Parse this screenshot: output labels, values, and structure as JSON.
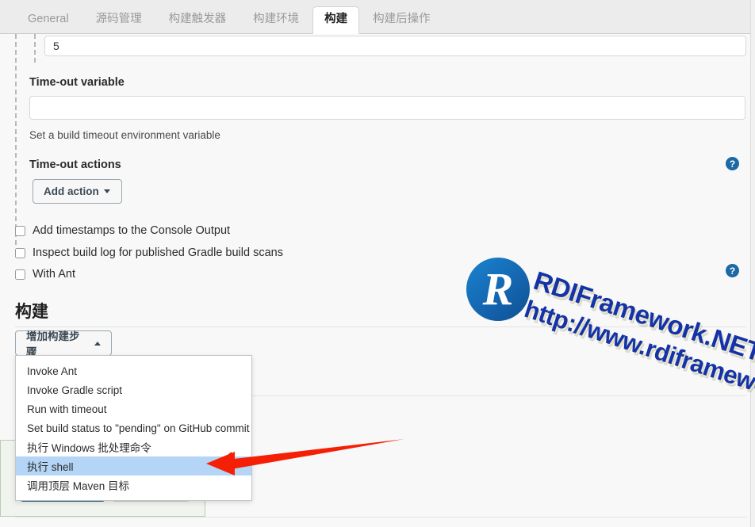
{
  "tabs": [
    {
      "label": "General",
      "active": false
    },
    {
      "label": "源码管理",
      "active": false
    },
    {
      "label": "构建触发器",
      "active": false
    },
    {
      "label": "构建环境",
      "active": false
    },
    {
      "label": "构建",
      "active": true
    },
    {
      "label": "构建后操作",
      "active": false
    }
  ],
  "form": {
    "timeout_minutes_value": "5",
    "timeout_variable_label": "Time-out variable",
    "timeout_variable_value": "",
    "timeout_variable_placeholder": "",
    "timeout_variable_help": "Set a build timeout environment variable",
    "timeout_actions_label": "Time-out actions",
    "add_action_label": "Add action"
  },
  "checkboxes": [
    {
      "label": "Add timestamps to the Console Output",
      "checked": false
    },
    {
      "label": "Inspect build log for published Gradle build scans",
      "checked": false
    },
    {
      "label": "With Ant",
      "checked": false
    }
  ],
  "help_icons": {
    "glyph": "?",
    "color": "#1b6aa5"
  },
  "build_section": {
    "title": "构建",
    "add_step_button_label": "增加构建步骤"
  },
  "build_step_menu": {
    "items": [
      {
        "label": "Invoke Ant",
        "highlighted": false
      },
      {
        "label": "Invoke Gradle script",
        "highlighted": false
      },
      {
        "label": "Run with timeout",
        "highlighted": false
      },
      {
        "label": "Set build status to \"pending\" on GitHub commit",
        "highlighted": false
      },
      {
        "label": "执行 Windows 批处理命令",
        "highlighted": false
      },
      {
        "label": "执行 shell",
        "highlighted": true
      },
      {
        "label": "调用顶层 Maven 目标",
        "highlighted": false
      }
    ]
  },
  "bottom_buttons": {
    "primary_label": "",
    "secondary_label": "",
    "primary_color": "#1b6aa5"
  },
  "annotation": {
    "arrow_color": "#f51f06"
  },
  "watermark": {
    "logo_letter": "R",
    "line1": "RDIFramework.NET",
    "line2": "http://www.rdiframework.net"
  }
}
